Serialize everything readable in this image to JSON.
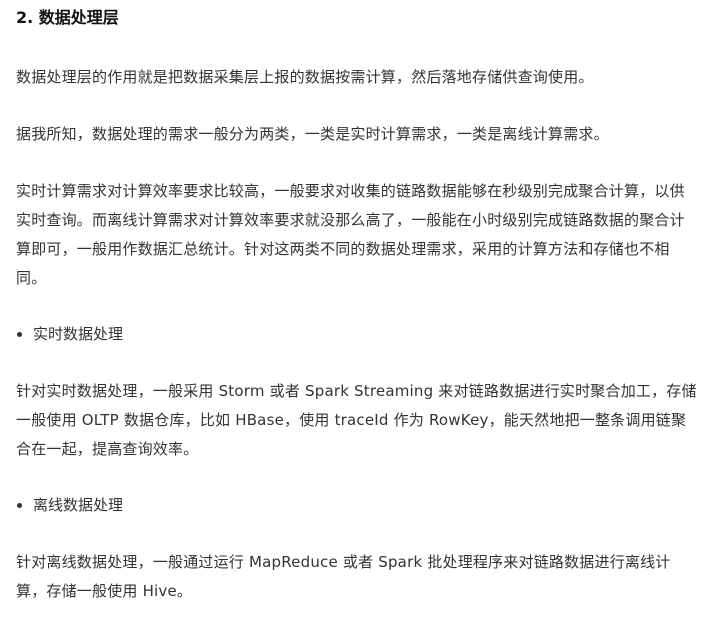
{
  "section": {
    "heading": "2. 数据处理层",
    "paragraphs": [
      "数据处理层的作用就是把数据采集层上报的数据按需计算，然后落地存储供查询使用。",
      "据我所知，数据处理的需求一般分为两类，一类是实时计算需求，一类是离线计算需求。",
      "实时计算需求对计算效率要求比较高，一般要求对收集的链路数据能够在秒级别完成聚合计算，以供实时查询。而离线计算需求对计算效率要求就没那么高了，一般能在小时级别完成链路数据的聚合计算即可，一般用作数据汇总统计。针对这两类不同的数据处理需求，采用的计算方法和存储也不相同。"
    ],
    "realtime": {
      "bullet": "实时数据处理",
      "text": "针对实时数据处理，一般采用 Storm 或者 Spark Streaming 来对链路数据进行实时聚合加工，存储一般使用 OLTP 数据仓库，比如 HBase，使用 traceId 作为 RowKey，能天然地把一整条调用链聚合在一起，提高查询效率。"
    },
    "offline": {
      "bullet": "离线数据处理",
      "text": "针对离线数据处理，一般通过运行 MapReduce 或者 Spark 批处理程序来对链路数据进行离线计算，存储一般使用 Hive。"
    }
  }
}
